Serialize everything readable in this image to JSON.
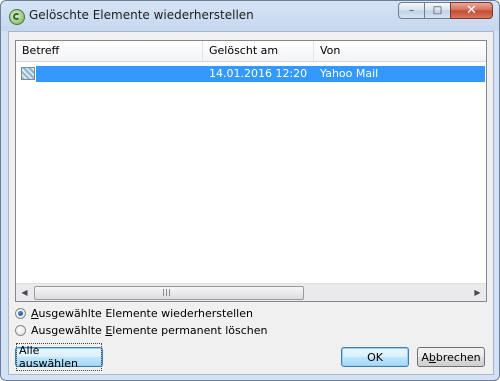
{
  "window": {
    "title": "Gelöschte Elemente wiederherstellen",
    "minimize": "–",
    "maximize": "□",
    "close": "✕"
  },
  "list": {
    "columns": [
      "Betreff",
      "Gelöscht am",
      "Von"
    ],
    "rows": [
      {
        "subject": "",
        "deleted_at": "14.01.2016 12:20",
        "from": "Yahoo Mail",
        "selected": true
      }
    ]
  },
  "scrollbar": {
    "left_arrow": "◀",
    "right_arrow": "▶"
  },
  "options": {
    "restore_pre": "",
    "restore_accel": "A",
    "restore_post": "usgewählte Elemente wiederherstellen",
    "delete_pre": "Ausgewählte ",
    "delete_accel": "E",
    "delete_post": "lemente permanent löschen",
    "selected": "restore"
  },
  "buttons": {
    "select_all": "Alle auswählen",
    "ok": "OK",
    "cancel_pre": "A",
    "cancel_accel": "b",
    "cancel_post": "brechen"
  },
  "colors": {
    "selection": "#3399ff",
    "window_frame": "#c6d7ee"
  }
}
